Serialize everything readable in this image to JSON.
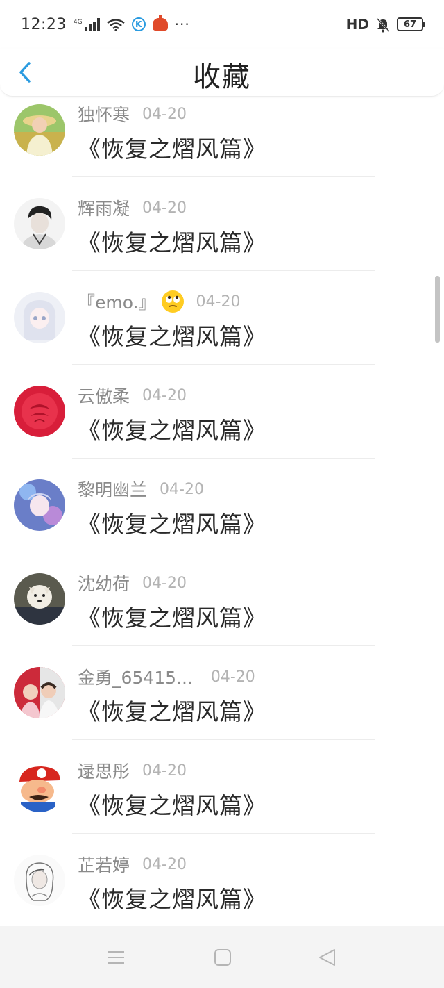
{
  "status_bar": {
    "time": "12:23",
    "network": "4G",
    "more": "···",
    "hd": "HD",
    "battery": "67"
  },
  "header": {
    "title": "收藏",
    "back_icon": "chevron-left-icon",
    "accent": "#2a9be0"
  },
  "items": [
    {
      "user": "独怀寒",
      "date": "04-20",
      "title": "《恢复之熠风篇》"
    },
    {
      "user": "辉雨凝",
      "date": "04-20",
      "title": "《恢复之熠风篇》"
    },
    {
      "user": "『emo.』",
      "emoji": "eye-roll-emoji",
      "date": "04-20",
      "title": "《恢复之熠风篇》"
    },
    {
      "user": "云傲柔",
      "date": "04-20",
      "title": "《恢复之熠风篇》"
    },
    {
      "user": "黎明幽兰",
      "date": "04-20",
      "title": "《恢复之熠风篇》"
    },
    {
      "user": "沈幼荷",
      "date": "04-20",
      "title": "《恢复之熠风篇》"
    },
    {
      "user": "金勇_65415...",
      "date": "04-20",
      "title": "《恢复之熠风篇》"
    },
    {
      "user": "逯思彤",
      "date": "04-20",
      "title": "《恢复之熠风篇》"
    },
    {
      "user": "芷若婷",
      "date": "04-20",
      "title": "《恢复之熠风篇》"
    }
  ],
  "nav_bar": {
    "menu_icon": "menu-icon",
    "home_icon": "home-square-icon",
    "back_icon": "back-triangle-icon"
  }
}
